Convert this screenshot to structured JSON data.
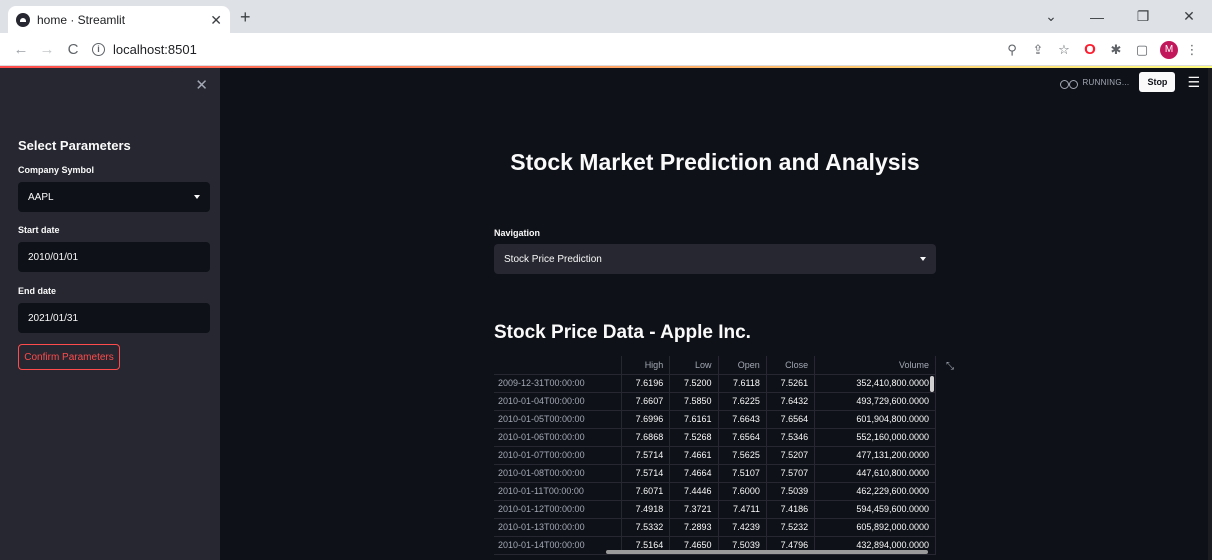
{
  "browser": {
    "tab_title": "home · Streamlit",
    "url": "localhost:8501",
    "profile_initial": "M"
  },
  "sidebar": {
    "title": "Select Parameters",
    "company_label": "Company Symbol",
    "company_value": "AAPL",
    "start_label": "Start date",
    "start_value": "2010/01/01",
    "end_label": "End date",
    "end_value": "2021/01/31",
    "confirm_label": "Confirm Parameters"
  },
  "toolbar": {
    "status": "RUNNING...",
    "stop_label": "Stop"
  },
  "main": {
    "title": "Stock Market Prediction and Analysis",
    "nav_label": "Navigation",
    "nav_value": "Stock Price Prediction",
    "section_title": "Stock Price Data - Apple Inc."
  },
  "table": {
    "columns": [
      "",
      "High",
      "Low",
      "Open",
      "Close",
      "Volume"
    ],
    "rows": [
      [
        "2009-12-31T00:00:00",
        "7.6196",
        "7.5200",
        "7.6118",
        "7.5261",
        "352,410,800.0000"
      ],
      [
        "2010-01-04T00:00:00",
        "7.6607",
        "7.5850",
        "7.6225",
        "7.6432",
        "493,729,600.0000"
      ],
      [
        "2010-01-05T00:00:00",
        "7.6996",
        "7.6161",
        "7.6643",
        "7.6564",
        "601,904,800.0000"
      ],
      [
        "2010-01-06T00:00:00",
        "7.6868",
        "7.5268",
        "7.6564",
        "7.5346",
        "552,160,000.0000"
      ],
      [
        "2010-01-07T00:00:00",
        "7.5714",
        "7.4661",
        "7.5625",
        "7.5207",
        "477,131,200.0000"
      ],
      [
        "2010-01-08T00:00:00",
        "7.5714",
        "7.4664",
        "7.5107",
        "7.5707",
        "447,610,800.0000"
      ],
      [
        "2010-01-11T00:00:00",
        "7.6071",
        "7.4446",
        "7.6000",
        "7.5039",
        "462,229,600.0000"
      ],
      [
        "2010-01-12T00:00:00",
        "7.4918",
        "7.3721",
        "7.4711",
        "7.4186",
        "594,459,600.0000"
      ],
      [
        "2010-01-13T00:00:00",
        "7.5332",
        "7.2893",
        "7.4239",
        "7.5232",
        "605,892,000.0000"
      ],
      [
        "2010-01-14T00:00:00",
        "7.5164",
        "7.4650",
        "7.5039",
        "7.4796",
        "432,894,000.0000"
      ]
    ]
  },
  "icons": {
    "tab_close": "✕",
    "new_tab": "+",
    "sidebar_close": "✕",
    "menu": "☰",
    "expand": "⤡"
  },
  "colors": {
    "accent": "#ff4b4b",
    "background": "#0e1117",
    "sidebar": "#262730",
    "text": "#fafafa"
  }
}
